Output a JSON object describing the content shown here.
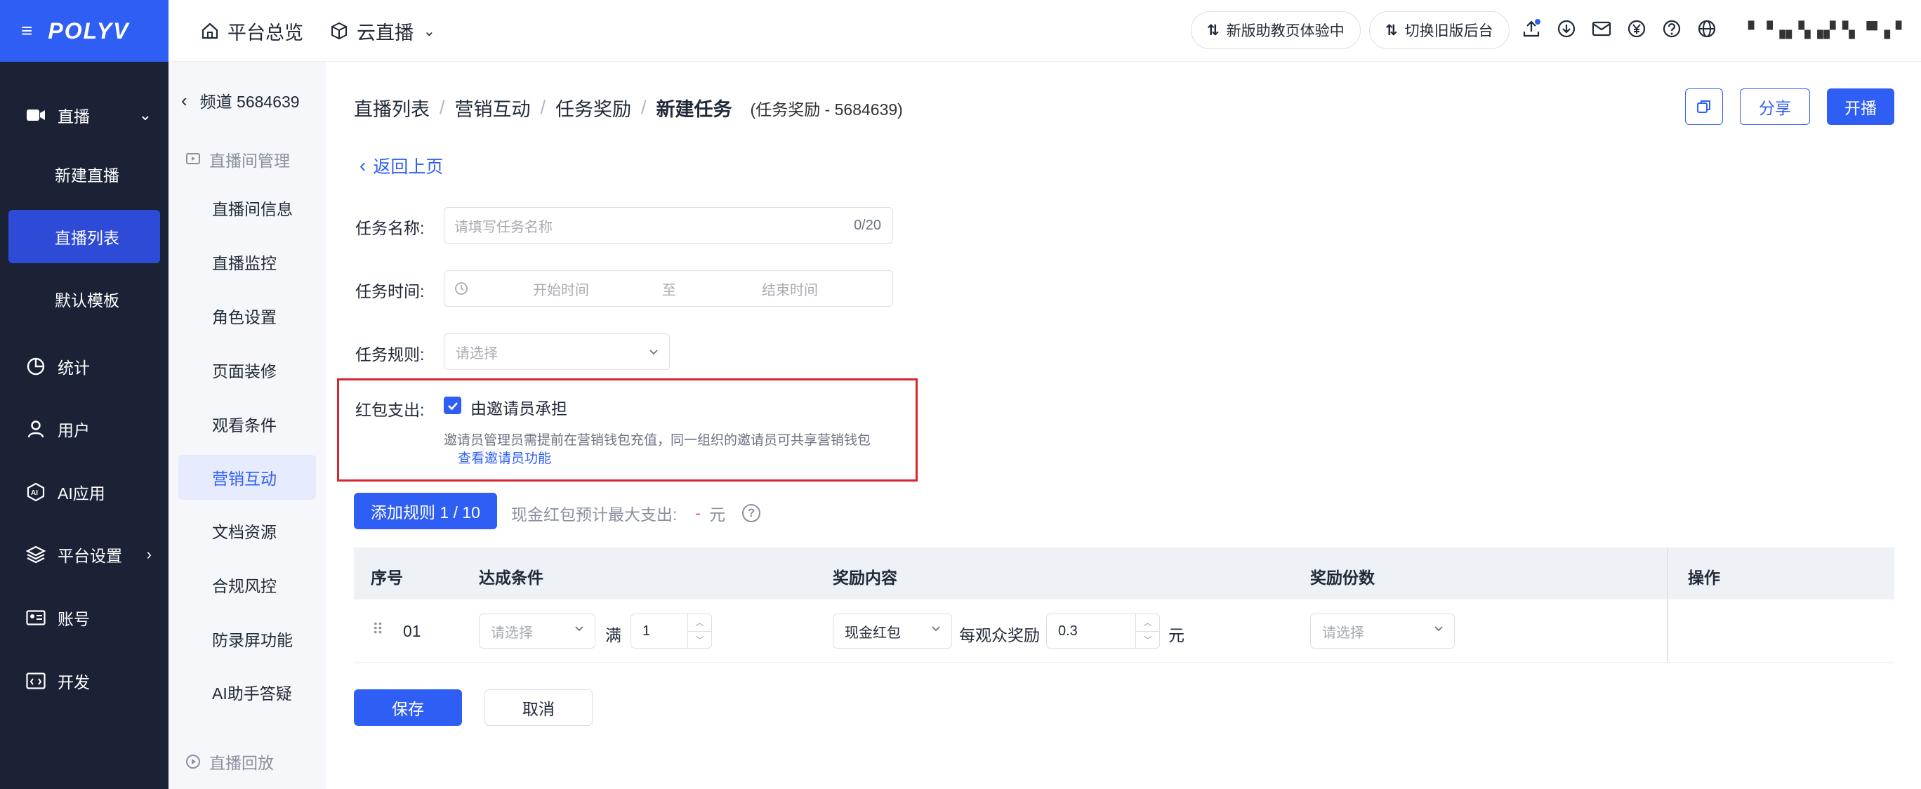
{
  "app": {
    "logo": "POLYV"
  },
  "leftnav": {
    "live": "直播",
    "live_sub": [
      "新建直播",
      "直播列表",
      "默认模板"
    ],
    "stats": "统计",
    "users": "用户",
    "ai": "AI应用",
    "platform": "平台设置",
    "account": "账号",
    "dev": "开发"
  },
  "topbar": {
    "overview": "平台总览",
    "cloudlive": "云直播",
    "pill1": "新版助教页体验中",
    "pill2": "切换旧版后台",
    "username": "▘▝▗▖▚▗▞▝▖ ▀▗ ▘"
  },
  "subnav": {
    "channel": "频道 5684639",
    "group1": "直播间管理",
    "items": [
      "直播间信息",
      "直播监控",
      "角色设置",
      "页面装修",
      "观看条件",
      "营销互动",
      "文档资源",
      "合规风控",
      "防录屏功能",
      "AI助手答疑"
    ],
    "group2": "直播回放"
  },
  "breadcrumb": {
    "items": [
      "直播列表",
      "营销互动",
      "任务奖励"
    ],
    "current": "新建任务",
    "meta": "(任务奖励 - 5684639)"
  },
  "header_buttons": {
    "share": "分享",
    "start": "开播"
  },
  "back": "返回上页",
  "form": {
    "name_label": "任务名称:",
    "name_placeholder": "请填写任务名称",
    "name_count": "0/20",
    "time_label": "任务时间:",
    "time_start": "开始时间",
    "time_sep": "至",
    "time_end": "结束时间",
    "rule_label": "任务规则:",
    "rule_placeholder": "请选择",
    "red_label": "红包支出:",
    "red_checkbox": "由邀请员承担",
    "red_hint": "邀请员管理员需提前在营销钱包充值，同一组织的邀请员可共享营销钱包",
    "red_link": "查看邀请员功能",
    "checked": true
  },
  "rules": {
    "add_button": "添加规则 1 / 10",
    "budget_label": "现金红包预计最大支出:",
    "budget_value": "-",
    "budget_unit": "元"
  },
  "table": {
    "headers": [
      "序号",
      "达成条件",
      "奖励内容",
      "奖励份数",
      "操作"
    ],
    "rows": [
      {
        "index": "01",
        "condition_placeholder": "请选择",
        "full_label": "满",
        "full_value": "1",
        "reward_type": "现金红包",
        "per_viewer_label": "每观众奖励",
        "per_viewer_value": "0.3",
        "unit": "元",
        "count_placeholder": "请选择"
      }
    ]
  },
  "footer": {
    "save": "保存",
    "cancel": "取消"
  }
}
